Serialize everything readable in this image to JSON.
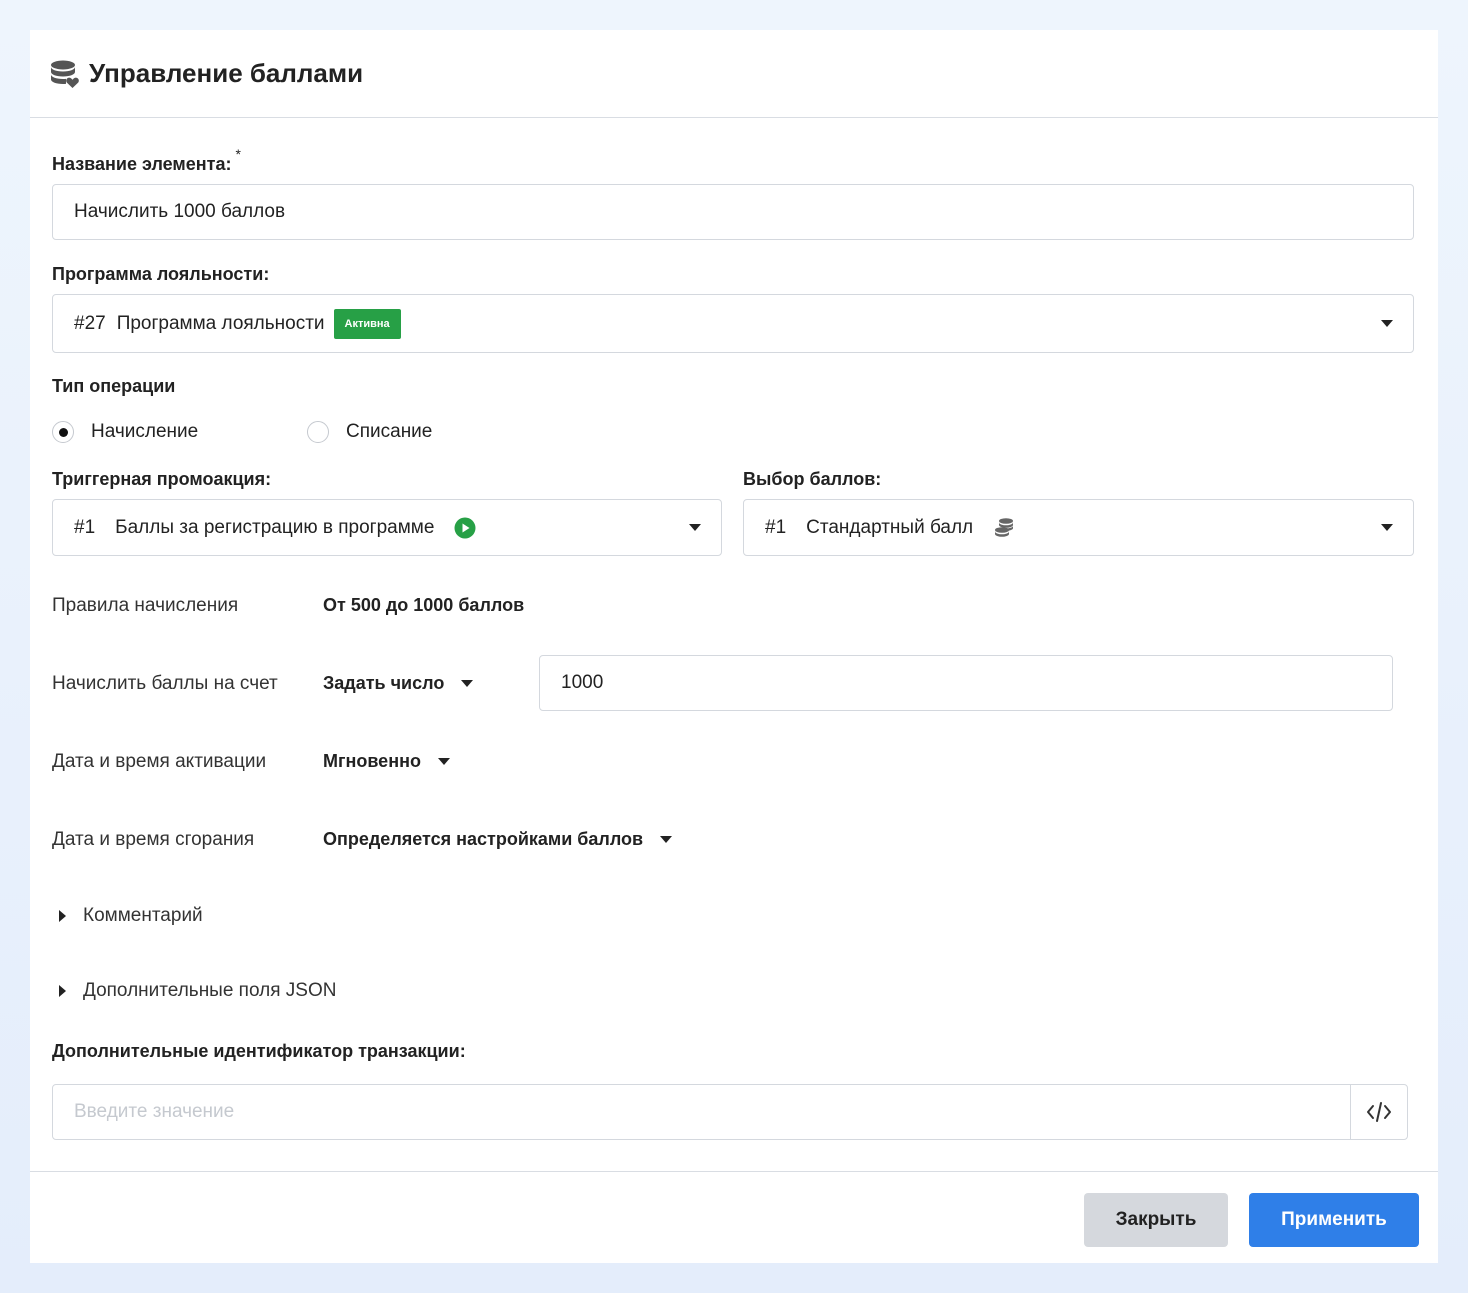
{
  "header": {
    "title": "Управление баллами",
    "icon": "database-heart-icon"
  },
  "form": {
    "name": {
      "label": "Название элемента:",
      "required_mark": "*",
      "value": "Начислить 1000 баллов"
    },
    "program": {
      "label": "Программа лояльности:",
      "id": "#27",
      "name": "Программа лояльности",
      "badge": "Активна",
      "badge_color": "#27a046"
    },
    "operation": {
      "label": "Тип операции",
      "options": [
        "Начисление",
        "Списание"
      ],
      "selected": "Начисление"
    },
    "trigger": {
      "label": "Триггерная промоакция:",
      "id": "#1",
      "name": "Баллы за регистрацию в программе",
      "icon": "play-circle-icon"
    },
    "points": {
      "label": "Выбор баллов:",
      "id": "#1",
      "name": "Стандартный балл",
      "icon": "coins-icon"
    },
    "rules": {
      "label": "Правила начисления",
      "value": "От 500 до 1000 баллов"
    },
    "accrue": {
      "label": "Начислить баллы на счет",
      "mode": "Задать число",
      "value": "1000"
    },
    "activation": {
      "label": "Дата и время активации",
      "value": "Мгновенно"
    },
    "expiry": {
      "label": "Дата и время сгорания",
      "value": "Определяется настройками баллов"
    },
    "comment": {
      "label": "Комментарий"
    },
    "json_fields": {
      "label": "Дополнительные поля JSON"
    },
    "transaction": {
      "label": "Дополнительные идентификатор транзакции:",
      "placeholder": "Введите значение",
      "code_icon": "code-icon"
    }
  },
  "footer": {
    "close_label": "Закрыть",
    "apply_label": "Применить",
    "apply_color": "#2f7fe8"
  }
}
